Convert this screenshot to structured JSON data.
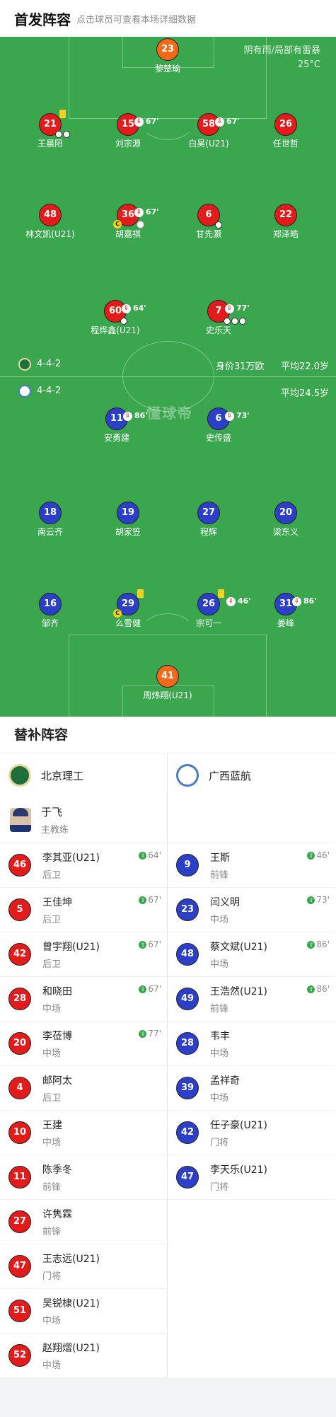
{
  "header": {
    "title": "首发阵容",
    "hint": "点击球员可查看本场详细数据"
  },
  "weather": {
    "condition": "阴有雨/局部有雷暴",
    "temp": "25°C"
  },
  "watermark": "懂球帝",
  "home": {
    "formation": "4-4-2",
    "value": "身价31万欧",
    "age": "平均22.0岁",
    "color": "#e31b1b",
    "players": [
      {
        "num": "23",
        "name": "黎楚瑜"
      },
      {
        "num": "21",
        "name": "王晨阳"
      },
      {
        "num": "15",
        "name": "刘宗源",
        "sub": "67'"
      },
      {
        "num": "58",
        "name": "白昊(U21)",
        "sub": "67'"
      },
      {
        "num": "26",
        "name": "任世哲"
      },
      {
        "num": "48",
        "name": "林文凯(U21)"
      },
      {
        "num": "36",
        "name": "胡嘉祺",
        "sub": "67'"
      },
      {
        "num": "6",
        "name": "甘先灏"
      },
      {
        "num": "22",
        "name": "郑泽皓"
      },
      {
        "num": "60",
        "name": "程烨鑫(U21)",
        "sub": "64'"
      },
      {
        "num": "7",
        "name": "史乐天",
        "sub": "77'"
      }
    ]
  },
  "away": {
    "formation": "4-4-2",
    "age": "平均24.5岁",
    "color": "#2b3fc9",
    "players": [
      {
        "num": "11",
        "name": "安勇建",
        "sub": "86'"
      },
      {
        "num": "6",
        "name": "史传盛",
        "sub": "73'"
      },
      {
        "num": "18",
        "name": "南云齐"
      },
      {
        "num": "19",
        "name": "胡家笠"
      },
      {
        "num": "27",
        "name": "程辉"
      },
      {
        "num": "20",
        "name": "梁东义"
      },
      {
        "num": "16",
        "name": "邹齐"
      },
      {
        "num": "29",
        "name": "么雪健"
      },
      {
        "num": "26",
        "name": "宗可一",
        "sub": "46'"
      },
      {
        "num": "31",
        "name": "姜峰",
        "sub": "86'"
      },
      {
        "num": "41",
        "name": "周炜翔(U21)"
      }
    ]
  },
  "subs": {
    "title": "替补阵容",
    "left": {
      "team": "北京理工",
      "coach": {
        "name": "于飞",
        "role": "主教练"
      },
      "players": [
        {
          "num": "46",
          "name": "李其亚(U21)",
          "pos": "后卫",
          "in": "64'"
        },
        {
          "num": "5",
          "name": "王佳坤",
          "pos": "后卫",
          "in": "67'"
        },
        {
          "num": "42",
          "name": "曾宇翔(U21)",
          "pos": "后卫",
          "in": "67'"
        },
        {
          "num": "28",
          "name": "和晓田",
          "pos": "中场",
          "in": "67'"
        },
        {
          "num": "20",
          "name": "李莅博",
          "pos": "中场",
          "in": "77'"
        },
        {
          "num": "4",
          "name": "邮阿太",
          "pos": "后卫"
        },
        {
          "num": "10",
          "name": "王建",
          "pos": "中场"
        },
        {
          "num": "11",
          "name": "陈季冬",
          "pos": "前锋"
        },
        {
          "num": "27",
          "name": "许隽霖",
          "pos": "前锋"
        },
        {
          "num": "47",
          "name": "王志远(U21)",
          "pos": "门将"
        },
        {
          "num": "51",
          "name": "吴锐棣(U21)",
          "pos": "中场"
        },
        {
          "num": "52",
          "name": "赵翔熠(U21)",
          "pos": "中场"
        }
      ]
    },
    "right": {
      "team": "广西蓝航",
      "players": [
        {
          "num": "9",
          "name": "王斯",
          "pos": "前锋",
          "in": "46'"
        },
        {
          "num": "23",
          "name": "闫义明",
          "pos": "中场",
          "in": "73'"
        },
        {
          "num": "48",
          "name": "蔡文斌(U21)",
          "pos": "中场",
          "in": "86'"
        },
        {
          "num": "49",
          "name": "王浩然(U21)",
          "pos": "前锋",
          "in": "86'"
        },
        {
          "num": "28",
          "name": "韦丰",
          "pos": "中场"
        },
        {
          "num": "39",
          "name": "孟祥奇",
          "pos": "中场"
        },
        {
          "num": "42",
          "name": "任子豪(U21)",
          "pos": "门将"
        },
        {
          "num": "47",
          "name": "李天乐(U21)",
          "pos": "门将"
        }
      ]
    }
  }
}
